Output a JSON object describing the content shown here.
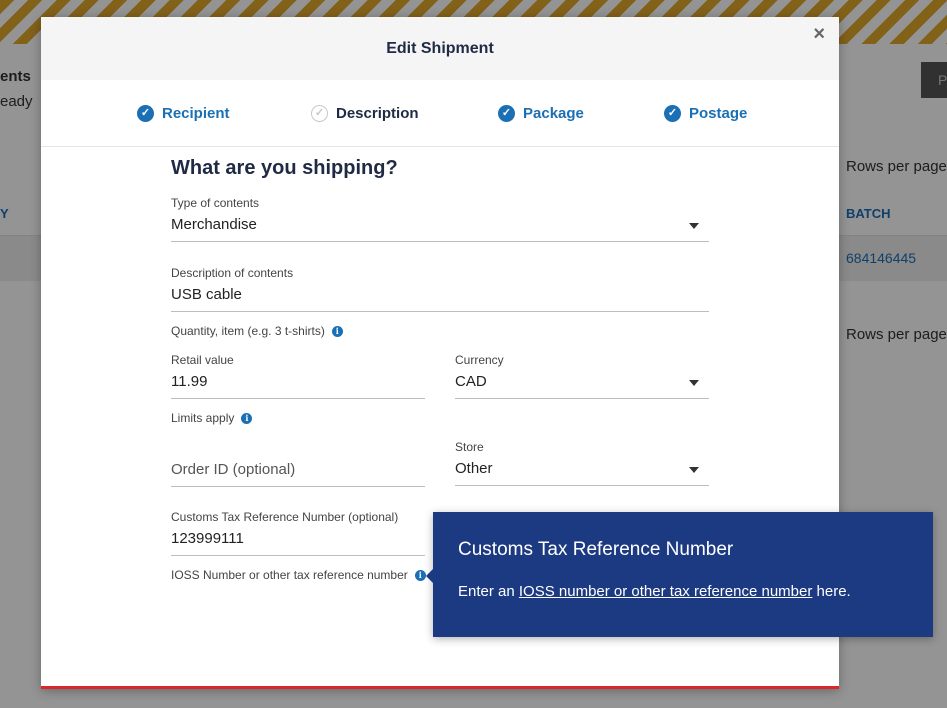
{
  "background": {
    "left_text_1": "ents",
    "left_text_2": "eady",
    "rows_per_page_1": "Rows per page",
    "rows_per_page_2": "Rows per page",
    "col_left": "Y",
    "col_batch": "BATCH",
    "batch_value": "684146445",
    "button_fragment": "P"
  },
  "modal": {
    "title": "Edit Shipment",
    "close_label": "×",
    "steps": [
      {
        "label": "Recipient",
        "state": "done"
      },
      {
        "label": "Description",
        "state": "current"
      },
      {
        "label": "Package",
        "state": "done"
      },
      {
        "label": "Postage",
        "state": "done"
      }
    ],
    "heading": "What are you shipping?",
    "type_of_contents": {
      "label": "Type of contents",
      "value": "Merchandise"
    },
    "description": {
      "label": "Description of contents",
      "value": "USB cable"
    },
    "quantity_hint": "Quantity, item (e.g. 3 t-shirts)",
    "retail_value": {
      "label": "Retail value",
      "value": "11.99"
    },
    "currency": {
      "label": "Currency",
      "value": "CAD"
    },
    "limits_hint": "Limits apply",
    "order_id": {
      "placeholder": "Order ID (optional)"
    },
    "store": {
      "label": "Store",
      "value": "Other"
    },
    "customs_tax": {
      "label": "Customs Tax Reference Number (optional)",
      "value": "123999111"
    },
    "ioss_hint": "IOSS Number or other tax reference number"
  },
  "tooltip": {
    "title": "Customs Tax Reference Number",
    "body_prefix": "Enter an ",
    "body_link": "IOSS number or other tax reference number",
    "body_suffix": " here."
  },
  "icons": {
    "check": "check-circle-icon",
    "info": "info-icon",
    "caret": "chevron-down-icon",
    "close": "close-icon"
  },
  "colors": {
    "accent_blue": "#1a6fb5",
    "tooltip_bg": "#1c3a82",
    "modal_bottom_border": "#d9272e",
    "stripe_yellow": "#e0a72c"
  }
}
